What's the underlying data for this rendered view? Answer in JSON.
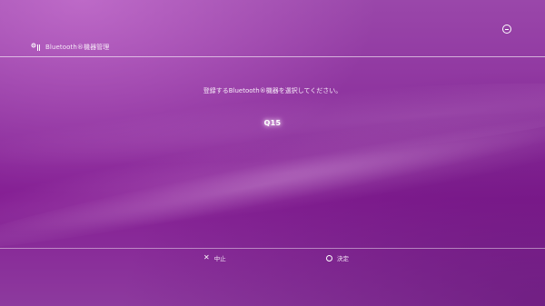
{
  "header": {
    "title": "Bluetooth®機器管理",
    "icon": "bluetooth-settings-icon"
  },
  "top_button": {
    "icon": "minus-circle-icon"
  },
  "main": {
    "message": "登録するBluetooth®機器を選択してください。",
    "device_name": "Q15"
  },
  "footer": {
    "cancel_label": "中止",
    "cancel_icon": "cross-icon",
    "confirm_label": "決定",
    "confirm_icon": "circle-icon"
  },
  "colors": {
    "background": "#8a2f9a",
    "text": "#ffffff"
  }
}
